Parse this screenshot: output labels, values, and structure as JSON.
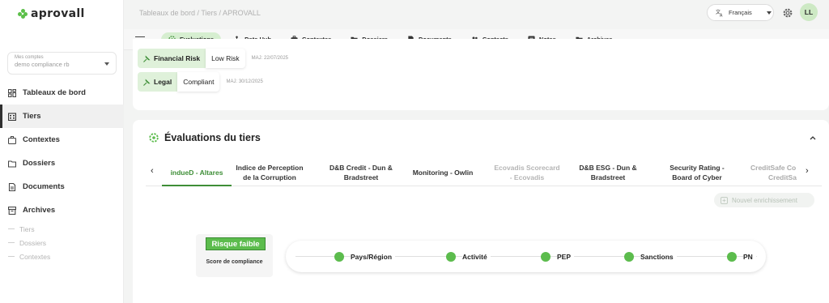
{
  "app": {
    "logo_text": "aprovall"
  },
  "breadcrumb": "Tableaux de bord / Tiers / APROVALL",
  "header": {
    "language": "Français",
    "avatar_initials": "LL"
  },
  "sidebar": {
    "account_label": "Mes comptes",
    "account_value": "demo compliance rb",
    "items": [
      {
        "label": "Tableaux de bord",
        "icon": "dashboard-icon",
        "active": false
      },
      {
        "label": "Tiers",
        "icon": "building-icon",
        "active": true
      },
      {
        "label": "Contextes",
        "icon": "briefcase-icon",
        "active": false
      },
      {
        "label": "Dossiers",
        "icon": "folder-icon",
        "active": false
      },
      {
        "label": "Documents",
        "icon": "document-icon",
        "active": false
      },
      {
        "label": "Archives",
        "icon": "archive-icon",
        "active": false
      }
    ],
    "archive_subitems": [
      "Tiers",
      "Dossiers",
      "Contextes"
    ]
  },
  "tabs": [
    {
      "label": "Evaluations",
      "icon": "evaluation-icon",
      "active": true
    },
    {
      "label": "Data Hub",
      "icon": "hub-icon",
      "active": false
    },
    {
      "label": "Contextes",
      "icon": "briefcase-icon",
      "active": false
    },
    {
      "label": "Dossiers",
      "icon": "folder-icon",
      "active": false
    },
    {
      "label": "Documents",
      "icon": "document-icon",
      "active": false
    },
    {
      "label": "Contacts",
      "icon": "contacts-icon",
      "active": false
    },
    {
      "label": "Notes",
      "icon": "notes-icon",
      "active": false
    },
    {
      "label": "Archives",
      "icon": "archive-icon",
      "active": false
    }
  ],
  "risks": [
    {
      "name": "Financial Risk",
      "value": "Low Risk",
      "updated": "MAJ: 22/07/2025"
    },
    {
      "name": "Legal",
      "value": "Compliant",
      "updated": "MAJ: 30/12/2025"
    }
  ],
  "evaluations": {
    "title": "Évaluations du tiers",
    "providers": [
      {
        "line1": "indueD - Altares",
        "line2": "",
        "state": "active"
      },
      {
        "line1": "Indice de Perception",
        "line2": "de la Corruption",
        "state": "normal"
      },
      {
        "line1": "D&B Credit - Dun &",
        "line2": "Bradstreet",
        "state": "normal"
      },
      {
        "line1": "Monitoring - Owlin",
        "line2": "",
        "state": "normal"
      },
      {
        "line1": "Ecovadis Scorecard",
        "line2": "- Ecovadis",
        "state": "muted"
      },
      {
        "line1": "D&B ESG - Dun &",
        "line2": "Bradstreet",
        "state": "normal"
      },
      {
        "line1": "Security Rating -",
        "line2": "Board of Cyber",
        "state": "normal"
      },
      {
        "line1": "CreditSafe Co",
        "line2": "CreditSa",
        "state": "cut"
      }
    ],
    "enrich_button": "Nouvel enrichissement",
    "score_badge": "Risque faible",
    "score_label": "Score de compliance",
    "checks": [
      "Pays/Région",
      "Activité",
      "PEP",
      "Sanctions",
      "PN"
    ]
  },
  "colors": {
    "accent": "#5cbc4d",
    "accent_dark": "#3e8e37",
    "tab_active_bg": "#d6eed0"
  }
}
